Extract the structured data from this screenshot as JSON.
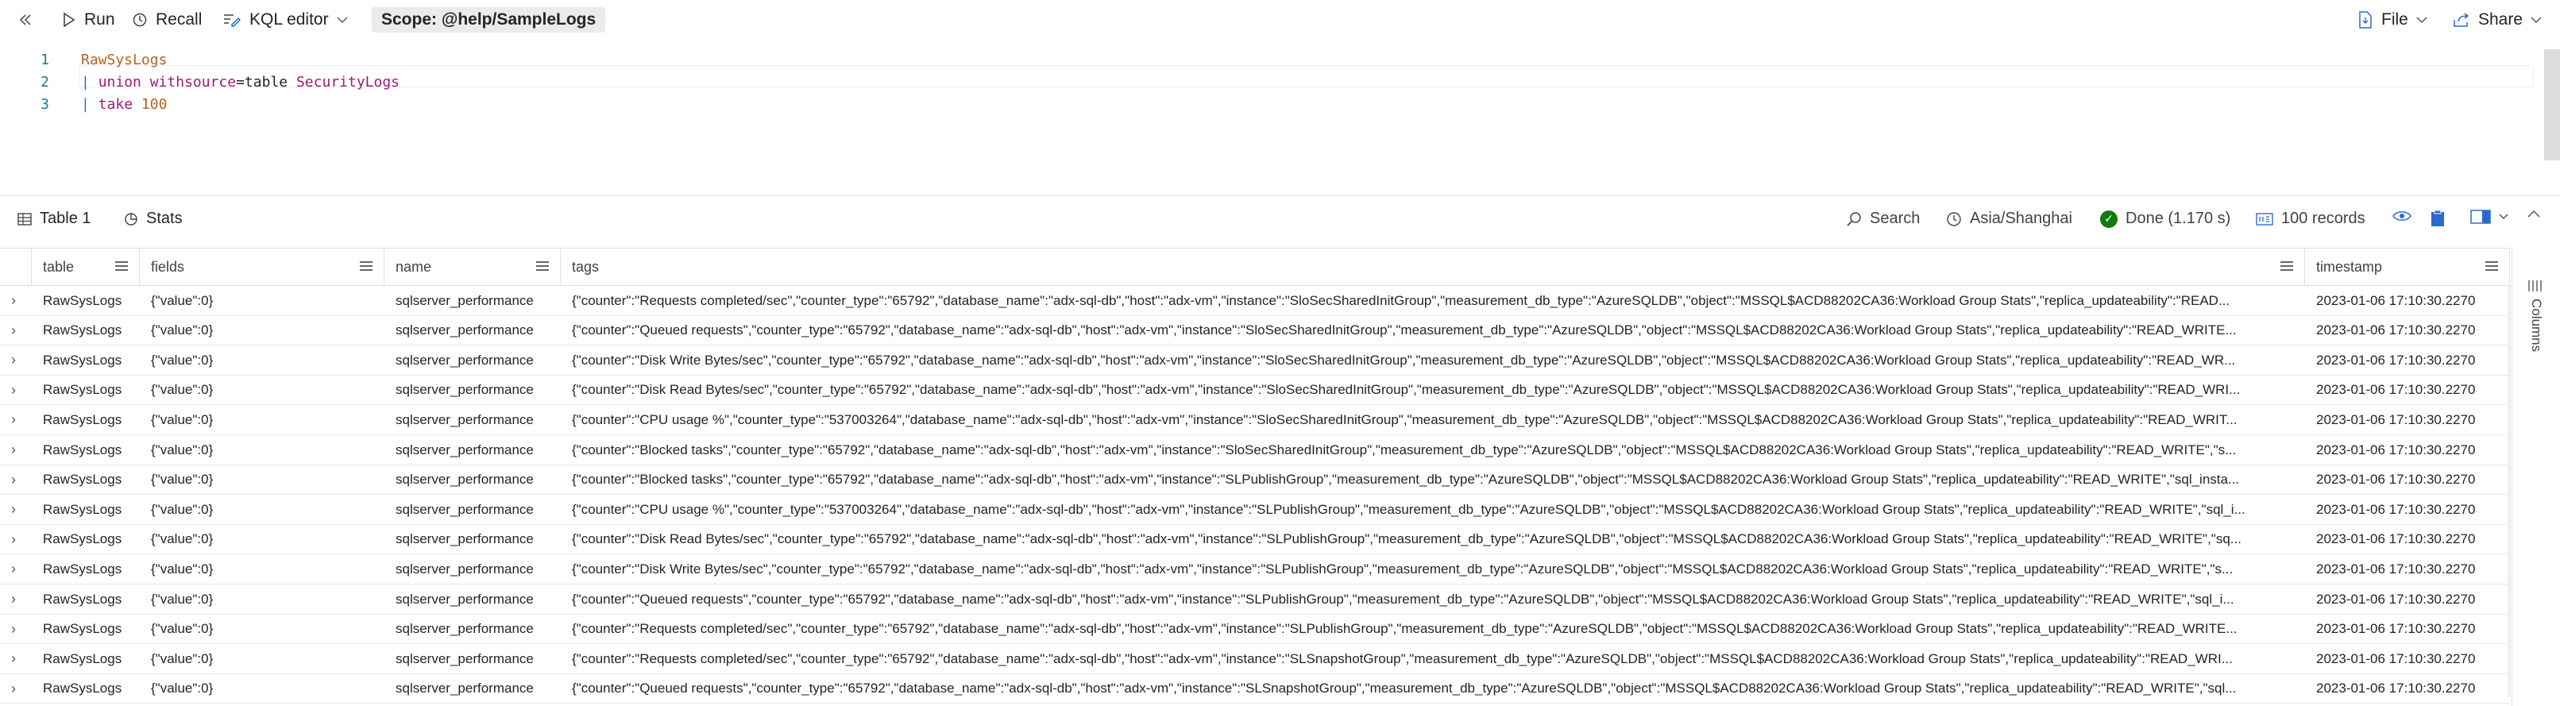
{
  "toolbar": {
    "collapse_icon": "double-chevron-left-icon",
    "run_label": "Run",
    "recall_label": "Recall",
    "kql_editor_label": "KQL editor",
    "scope_label": "Scope: @help/SampleLogs",
    "file_label": "File",
    "share_label": "Share"
  },
  "editor": {
    "lines": [
      {
        "num": "1",
        "tokens": [
          "RawSysLogs"
        ]
      },
      {
        "num": "2",
        "tokens": [
          "|",
          "union",
          "withsource",
          "=table",
          "SecurityLogs"
        ]
      },
      {
        "num": "3",
        "tokens": [
          "|",
          "take",
          "100"
        ]
      }
    ]
  },
  "results": {
    "tabs": [
      {
        "label": "Table 1"
      },
      {
        "label": "Stats"
      }
    ],
    "search_label": "Search",
    "timezone": "Asia/Shanghai",
    "status": "Done (1.170 s)",
    "records": "100 records",
    "columns_panel_label": "Columns"
  },
  "grid": {
    "columns": [
      "table",
      "fields",
      "name",
      "tags",
      "timestamp"
    ],
    "rows": [
      [
        "RawSysLogs",
        "{\"value\":0}",
        "sqlserver_performance",
        "{\"counter\":\"Requests completed/sec\",\"counter_type\":\"65792\",\"database_name\":\"adx-sql-db\",\"host\":\"adx-vm\",\"instance\":\"SloSecSharedInitGroup\",\"measurement_db_type\":\"AzureSQLDB\",\"object\":\"MSSQL$ACD88202CA36:Workload Group Stats\",\"replica_updateability\":\"READ...",
        "2023-01-06 17:10:30.2270"
      ],
      [
        "RawSysLogs",
        "{\"value\":0}",
        "sqlserver_performance",
        "{\"counter\":\"Queued requests\",\"counter_type\":\"65792\",\"database_name\":\"adx-sql-db\",\"host\":\"adx-vm\",\"instance\":\"SloSecSharedInitGroup\",\"measurement_db_type\":\"AzureSQLDB\",\"object\":\"MSSQL$ACD88202CA36:Workload Group Stats\",\"replica_updateability\":\"READ_WRITE...",
        "2023-01-06 17:10:30.2270"
      ],
      [
        "RawSysLogs",
        "{\"value\":0}",
        "sqlserver_performance",
        "{\"counter\":\"Disk Write Bytes/sec\",\"counter_type\":\"65792\",\"database_name\":\"adx-sql-db\",\"host\":\"adx-vm\",\"instance\":\"SloSecSharedInitGroup\",\"measurement_db_type\":\"AzureSQLDB\",\"object\":\"MSSQL$ACD88202CA36:Workload Group Stats\",\"replica_updateability\":\"READ_WR...",
        "2023-01-06 17:10:30.2270"
      ],
      [
        "RawSysLogs",
        "{\"value\":0}",
        "sqlserver_performance",
        "{\"counter\":\"Disk Read Bytes/sec\",\"counter_type\":\"65792\",\"database_name\":\"adx-sql-db\",\"host\":\"adx-vm\",\"instance\":\"SloSecSharedInitGroup\",\"measurement_db_type\":\"AzureSQLDB\",\"object\":\"MSSQL$ACD88202CA36:Workload Group Stats\",\"replica_updateability\":\"READ_WRI...",
        "2023-01-06 17:10:30.2270"
      ],
      [
        "RawSysLogs",
        "{\"value\":0}",
        "sqlserver_performance",
        "{\"counter\":\"CPU usage %\",\"counter_type\":\"537003264\",\"database_name\":\"adx-sql-db\",\"host\":\"adx-vm\",\"instance\":\"SloSecSharedInitGroup\",\"measurement_db_type\":\"AzureSQLDB\",\"object\":\"MSSQL$ACD88202CA36:Workload Group Stats\",\"replica_updateability\":\"READ_WRIT...",
        "2023-01-06 17:10:30.2270"
      ],
      [
        "RawSysLogs",
        "{\"value\":0}",
        "sqlserver_performance",
        "{\"counter\":\"Blocked tasks\",\"counter_type\":\"65792\",\"database_name\":\"adx-sql-db\",\"host\":\"adx-vm\",\"instance\":\"SloSecSharedInitGroup\",\"measurement_db_type\":\"AzureSQLDB\",\"object\":\"MSSQL$ACD88202CA36:Workload Group Stats\",\"replica_updateability\":\"READ_WRITE\",\"s...",
        "2023-01-06 17:10:30.2270"
      ],
      [
        "RawSysLogs",
        "{\"value\":0}",
        "sqlserver_performance",
        "{\"counter\":\"Blocked tasks\",\"counter_type\":\"65792\",\"database_name\":\"adx-sql-db\",\"host\":\"adx-vm\",\"instance\":\"SLPublishGroup\",\"measurement_db_type\":\"AzureSQLDB\",\"object\":\"MSSQL$ACD88202CA36:Workload Group Stats\",\"replica_updateability\":\"READ_WRITE\",\"sql_insta...",
        "2023-01-06 17:10:30.2270"
      ],
      [
        "RawSysLogs",
        "{\"value\":0}",
        "sqlserver_performance",
        "{\"counter\":\"CPU usage %\",\"counter_type\":\"537003264\",\"database_name\":\"adx-sql-db\",\"host\":\"adx-vm\",\"instance\":\"SLPublishGroup\",\"measurement_db_type\":\"AzureSQLDB\",\"object\":\"MSSQL$ACD88202CA36:Workload Group Stats\",\"replica_updateability\":\"READ_WRITE\",\"sql_i...",
        "2023-01-06 17:10:30.2270"
      ],
      [
        "RawSysLogs",
        "{\"value\":0}",
        "sqlserver_performance",
        "{\"counter\":\"Disk Read Bytes/sec\",\"counter_type\":\"65792\",\"database_name\":\"adx-sql-db\",\"host\":\"adx-vm\",\"instance\":\"SLPublishGroup\",\"measurement_db_type\":\"AzureSQLDB\",\"object\":\"MSSQL$ACD88202CA36:Workload Group Stats\",\"replica_updateability\":\"READ_WRITE\",\"sq...",
        "2023-01-06 17:10:30.2270"
      ],
      [
        "RawSysLogs",
        "{\"value\":0}",
        "sqlserver_performance",
        "{\"counter\":\"Disk Write Bytes/sec\",\"counter_type\":\"65792\",\"database_name\":\"adx-sql-db\",\"host\":\"adx-vm\",\"instance\":\"SLPublishGroup\",\"measurement_db_type\":\"AzureSQLDB\",\"object\":\"MSSQL$ACD88202CA36:Workload Group Stats\",\"replica_updateability\":\"READ_WRITE\",\"s...",
        "2023-01-06 17:10:30.2270"
      ],
      [
        "RawSysLogs",
        "{\"value\":0}",
        "sqlserver_performance",
        "{\"counter\":\"Queued requests\",\"counter_type\":\"65792\",\"database_name\":\"adx-sql-db\",\"host\":\"adx-vm\",\"instance\":\"SLPublishGroup\",\"measurement_db_type\":\"AzureSQLDB\",\"object\":\"MSSQL$ACD88202CA36:Workload Group Stats\",\"replica_updateability\":\"READ_WRITE\",\"sql_i...",
        "2023-01-06 17:10:30.2270"
      ],
      [
        "RawSysLogs",
        "{\"value\":0}",
        "sqlserver_performance",
        "{\"counter\":\"Requests completed/sec\",\"counter_type\":\"65792\",\"database_name\":\"adx-sql-db\",\"host\":\"adx-vm\",\"instance\":\"SLPublishGroup\",\"measurement_db_type\":\"AzureSQLDB\",\"object\":\"MSSQL$ACD88202CA36:Workload Group Stats\",\"replica_updateability\":\"READ_WRITE...",
        "2023-01-06 17:10:30.2270"
      ],
      [
        "RawSysLogs",
        "{\"value\":0}",
        "sqlserver_performance",
        "{\"counter\":\"Requests completed/sec\",\"counter_type\":\"65792\",\"database_name\":\"adx-sql-db\",\"host\":\"adx-vm\",\"instance\":\"SLSnapshotGroup\",\"measurement_db_type\":\"AzureSQLDB\",\"object\":\"MSSQL$ACD88202CA36:Workload Group Stats\",\"replica_updateability\":\"READ_WRI...",
        "2023-01-06 17:10:30.2270"
      ],
      [
        "RawSysLogs",
        "{\"value\":0}",
        "sqlserver_performance",
        "{\"counter\":\"Queued requests\",\"counter_type\":\"65792\",\"database_name\":\"adx-sql-db\",\"host\":\"adx-vm\",\"instance\":\"SLSnapshotGroup\",\"measurement_db_type\":\"AzureSQLDB\",\"object\":\"MSSQL$ACD88202CA36:Workload Group Stats\",\"replica_updateability\":\"READ_WRITE\",\"sql...",
        "2023-01-06 17:10:30.2270"
      ]
    ]
  },
  "colors": {
    "accent": "#0f6cbd",
    "done_green": "#107c10"
  }
}
